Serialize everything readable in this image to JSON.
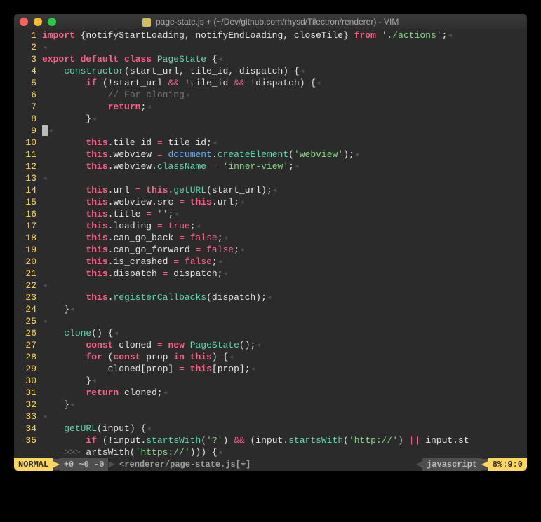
{
  "titlebar": {
    "title": "page-state.js + (~/Dev/github.com/rhysd/Tilectron/renderer) - VIM"
  },
  "gutter": {
    "start": 1,
    "end": 35
  },
  "code": {
    "lines": [
      [
        [
          "kw",
          "import"
        ],
        [
          "punct",
          " {"
        ],
        [
          "punct",
          "notifyStartLoading, notifyEndLoading, closeTile"
        ],
        [
          "punct",
          "} "
        ],
        [
          "kw",
          "from"
        ],
        [
          "punct",
          " "
        ],
        [
          "str",
          "'./actions'"
        ],
        [
          "punct",
          ";"
        ],
        [
          "ws",
          "◂"
        ]
      ],
      [
        [
          "ws",
          "◂"
        ]
      ],
      [
        [
          "kw",
          "export"
        ],
        [
          "punct",
          " "
        ],
        [
          "kw",
          "default"
        ],
        [
          "punct",
          " "
        ],
        [
          "kw",
          "class"
        ],
        [
          "punct",
          " "
        ],
        [
          "fn",
          "PageState"
        ],
        [
          "punct",
          " {"
        ],
        [
          "ws",
          "◂"
        ]
      ],
      [
        [
          "punct",
          "    "
        ],
        [
          "fn",
          "constructor"
        ],
        [
          "punct",
          "(start_url, tile_id, dispatch) {"
        ],
        [
          "ws",
          "◂"
        ]
      ],
      [
        [
          "punct",
          "        "
        ],
        [
          "kw",
          "if"
        ],
        [
          "punct",
          " (!start_url "
        ],
        [
          "op",
          "&&"
        ],
        [
          "punct",
          " !tile_id "
        ],
        [
          "op",
          "&&"
        ],
        [
          "punct",
          " !dispatch) {"
        ],
        [
          "ws",
          "◂"
        ]
      ],
      [
        [
          "punct",
          "            "
        ],
        [
          "comment",
          "// For cloning"
        ],
        [
          "ws",
          "◂"
        ]
      ],
      [
        [
          "punct",
          "            "
        ],
        [
          "kw",
          "return"
        ],
        [
          "punct",
          ";"
        ],
        [
          "ws",
          "◂"
        ]
      ],
      [
        [
          "punct",
          "        }"
        ],
        [
          "ws",
          "◂"
        ]
      ],
      [
        [
          "cursor",
          ""
        ],
        [
          "ws",
          "◂"
        ]
      ],
      [
        [
          "punct",
          "        "
        ],
        [
          "kw",
          "this"
        ],
        [
          "punct",
          ".tile_id "
        ],
        [
          "op",
          "="
        ],
        [
          "punct",
          " tile_id;"
        ],
        [
          "ws",
          "◂"
        ]
      ],
      [
        [
          "punct",
          "        "
        ],
        [
          "kw",
          "this"
        ],
        [
          "punct",
          ".webview "
        ],
        [
          "op",
          "="
        ],
        [
          "punct",
          " "
        ],
        [
          "special",
          "document"
        ],
        [
          "punct",
          "."
        ],
        [
          "fn",
          "createElement"
        ],
        [
          "punct",
          "("
        ],
        [
          "str",
          "'webview'"
        ],
        [
          "punct",
          ");"
        ],
        [
          "ws",
          "◂"
        ]
      ],
      [
        [
          "punct",
          "        "
        ],
        [
          "kw",
          "this"
        ],
        [
          "punct",
          ".webview."
        ],
        [
          "fn",
          "className"
        ],
        [
          "punct",
          " "
        ],
        [
          "op",
          "="
        ],
        [
          "punct",
          " "
        ],
        [
          "str",
          "'inner-view'"
        ],
        [
          "punct",
          ";"
        ],
        [
          "ws",
          "◂"
        ]
      ],
      [
        [
          "ws",
          "◂"
        ]
      ],
      [
        [
          "punct",
          "        "
        ],
        [
          "kw",
          "this"
        ],
        [
          "punct",
          ".url "
        ],
        [
          "op",
          "="
        ],
        [
          "punct",
          " "
        ],
        [
          "kw",
          "this"
        ],
        [
          "punct",
          "."
        ],
        [
          "fn",
          "getURL"
        ],
        [
          "punct",
          "(start_url);"
        ],
        [
          "ws",
          "◂"
        ]
      ],
      [
        [
          "punct",
          "        "
        ],
        [
          "kw",
          "this"
        ],
        [
          "punct",
          ".webview.src "
        ],
        [
          "op",
          "="
        ],
        [
          "punct",
          " "
        ],
        [
          "kw",
          "this"
        ],
        [
          "punct",
          ".url;"
        ],
        [
          "ws",
          "◂"
        ]
      ],
      [
        [
          "punct",
          "        "
        ],
        [
          "kw",
          "this"
        ],
        [
          "punct",
          ".title "
        ],
        [
          "op",
          "="
        ],
        [
          "punct",
          " "
        ],
        [
          "str",
          "''"
        ],
        [
          "punct",
          ";"
        ],
        [
          "ws",
          "◂"
        ]
      ],
      [
        [
          "punct",
          "        "
        ],
        [
          "kw",
          "this"
        ],
        [
          "punct",
          ".loading "
        ],
        [
          "op",
          "="
        ],
        [
          "punct",
          " "
        ],
        [
          "bool",
          "true"
        ],
        [
          "punct",
          ";"
        ],
        [
          "ws",
          "◂"
        ]
      ],
      [
        [
          "punct",
          "        "
        ],
        [
          "kw",
          "this"
        ],
        [
          "punct",
          ".can_go_back "
        ],
        [
          "op",
          "="
        ],
        [
          "punct",
          " "
        ],
        [
          "bool",
          "false"
        ],
        [
          "punct",
          ";"
        ],
        [
          "ws",
          "◂"
        ]
      ],
      [
        [
          "punct",
          "        "
        ],
        [
          "kw",
          "this"
        ],
        [
          "punct",
          ".can_go_forward "
        ],
        [
          "op",
          "="
        ],
        [
          "punct",
          " "
        ],
        [
          "bool",
          "false"
        ],
        [
          "punct",
          ";"
        ],
        [
          "ws",
          "◂"
        ]
      ],
      [
        [
          "punct",
          "        "
        ],
        [
          "kw",
          "this"
        ],
        [
          "punct",
          ".is_crashed "
        ],
        [
          "op",
          "="
        ],
        [
          "punct",
          " "
        ],
        [
          "bool",
          "false"
        ],
        [
          "punct",
          ";"
        ],
        [
          "ws",
          "◂"
        ]
      ],
      [
        [
          "punct",
          "        "
        ],
        [
          "kw",
          "this"
        ],
        [
          "punct",
          ".dispatch "
        ],
        [
          "op",
          "="
        ],
        [
          "punct",
          " dispatch;"
        ],
        [
          "ws",
          "◂"
        ]
      ],
      [
        [
          "ws",
          "◂"
        ]
      ],
      [
        [
          "punct",
          "        "
        ],
        [
          "kw",
          "this"
        ],
        [
          "punct",
          "."
        ],
        [
          "fn",
          "registerCallbacks"
        ],
        [
          "punct",
          "(dispatch);"
        ],
        [
          "ws",
          "◂"
        ]
      ],
      [
        [
          "punct",
          "    }"
        ],
        [
          "ws",
          "◂"
        ]
      ],
      [
        [
          "ws",
          "◂"
        ]
      ],
      [
        [
          "punct",
          "    "
        ],
        [
          "fn",
          "clone"
        ],
        [
          "punct",
          "() {"
        ],
        [
          "ws",
          "◂"
        ]
      ],
      [
        [
          "punct",
          "        "
        ],
        [
          "kw",
          "const"
        ],
        [
          "punct",
          " cloned "
        ],
        [
          "op",
          "="
        ],
        [
          "punct",
          " "
        ],
        [
          "kw",
          "new"
        ],
        [
          "punct",
          " "
        ],
        [
          "fn",
          "PageState"
        ],
        [
          "punct",
          "();"
        ],
        [
          "ws",
          "◂"
        ]
      ],
      [
        [
          "punct",
          "        "
        ],
        [
          "kw",
          "for"
        ],
        [
          "punct",
          " ("
        ],
        [
          "kw",
          "const"
        ],
        [
          "punct",
          " prop "
        ],
        [
          "kw",
          "in"
        ],
        [
          "punct",
          " "
        ],
        [
          "kw",
          "this"
        ],
        [
          "punct",
          ") {"
        ],
        [
          "ws",
          "◂"
        ]
      ],
      [
        [
          "punct",
          "            cloned[prop] "
        ],
        [
          "op",
          "="
        ],
        [
          "punct",
          " "
        ],
        [
          "kw",
          "this"
        ],
        [
          "punct",
          "[prop];"
        ],
        [
          "ws",
          "◂"
        ]
      ],
      [
        [
          "punct",
          "        }"
        ],
        [
          "ws",
          "◂"
        ]
      ],
      [
        [
          "punct",
          "        "
        ],
        [
          "kw",
          "return"
        ],
        [
          "punct",
          " cloned;"
        ],
        [
          "ws",
          "◂"
        ]
      ],
      [
        [
          "punct",
          "    }"
        ],
        [
          "ws",
          "◂"
        ]
      ],
      [
        [
          "ws",
          "◂"
        ]
      ],
      [
        [
          "punct",
          "    "
        ],
        [
          "fn",
          "getURL"
        ],
        [
          "punct",
          "(input) {"
        ],
        [
          "ws",
          "◂"
        ]
      ],
      [
        [
          "punct",
          "        "
        ],
        [
          "kw",
          "if"
        ],
        [
          "punct",
          " (!input."
        ],
        [
          "fn",
          "startsWith"
        ],
        [
          "punct",
          "("
        ],
        [
          "str",
          "'?'"
        ],
        [
          "punct",
          ") "
        ],
        [
          "op",
          "&&"
        ],
        [
          "punct",
          " (input."
        ],
        [
          "fn",
          "startsWith"
        ],
        [
          "punct",
          "("
        ],
        [
          "str",
          "'http://'"
        ],
        [
          "punct",
          ") "
        ],
        [
          "op",
          "||"
        ],
        [
          "punct",
          " input.st"
        ]
      ],
      [
        [
          "comment",
          "    >>> "
        ],
        [
          "punct",
          "artsWith("
        ],
        [
          "str",
          "'https://'"
        ],
        [
          "punct",
          "))) {"
        ],
        [
          "ws",
          "◂"
        ]
      ]
    ]
  },
  "status": {
    "mode": "NORMAL",
    "git": "+0 ~0 -0",
    "file": "<renderer/page-state.js[+]",
    "filetype": "javascript",
    "percent": "8%",
    "line": "9",
    "col": "0"
  }
}
